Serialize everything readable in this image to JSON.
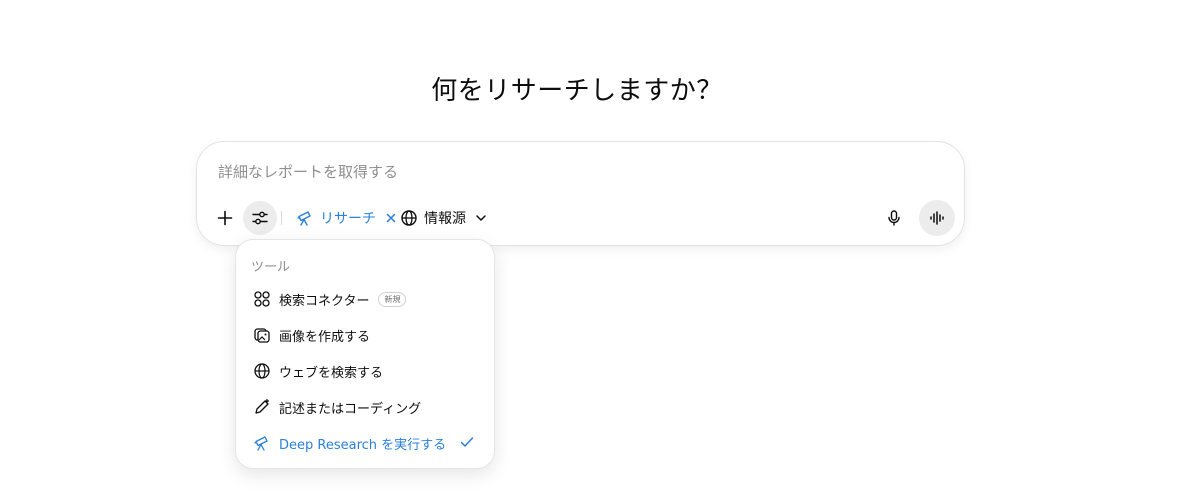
{
  "heading": "何をリサーチしますか？",
  "composer": {
    "placeholder": "詳細なレポートを取得する",
    "research_pill_label": "リサーチ",
    "sources_label": "情報源"
  },
  "menu": {
    "header": "ツール",
    "items": [
      {
        "label": "検索コネクター",
        "badge": "新規",
        "icon": "connector-icon"
      },
      {
        "label": "画像を作成する",
        "icon": "image-icon"
      },
      {
        "label": "ウェブを検索する",
        "icon": "globe-icon"
      },
      {
        "label": "記述またはコーディング",
        "icon": "pen-icon"
      },
      {
        "label": "Deep Research を実行する",
        "icon": "telescope-icon",
        "selected": true
      }
    ]
  },
  "colors": {
    "accent": "#2a7fdb",
    "text": "#0d0d0d",
    "muted": "#8f8f8f"
  }
}
